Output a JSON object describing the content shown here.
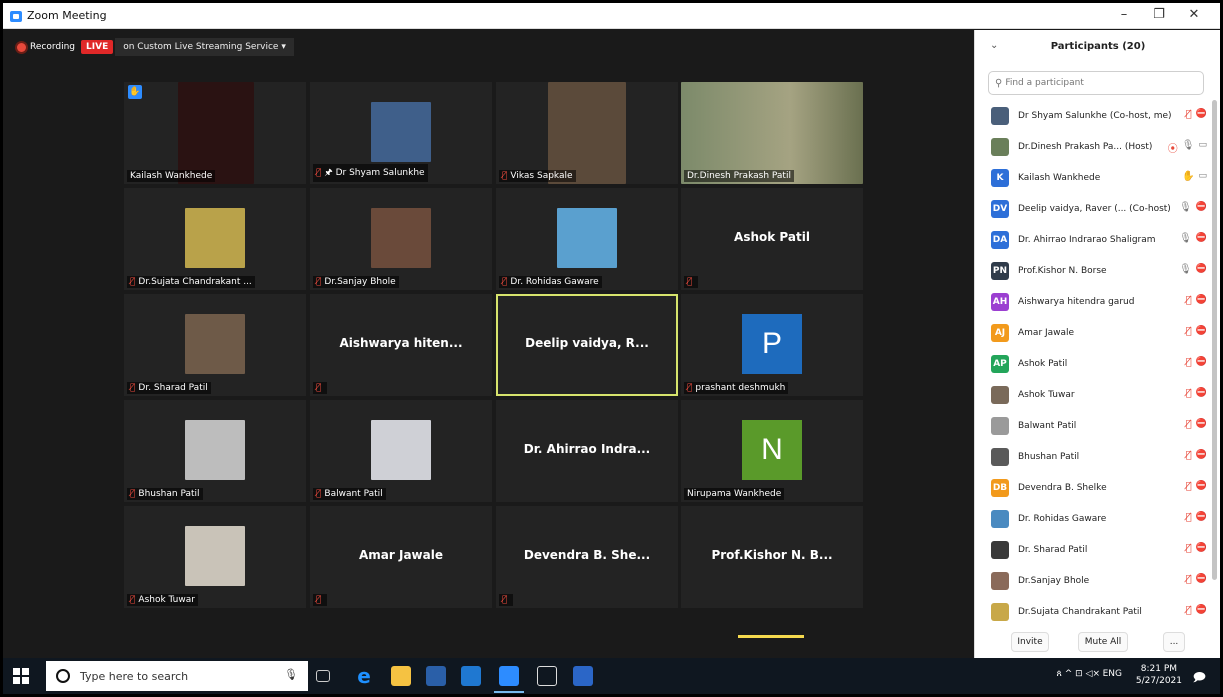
{
  "window": {
    "title": "Zoom Meeting",
    "minimize": "–",
    "restore": "❐",
    "close": "✕"
  },
  "topbar": {
    "recording": "Recording",
    "live": "LIVE",
    "stream": "on Custom Live Streaming Service  ▾"
  },
  "tiles": [
    {
      "name": "Kailash Wankhede",
      "center": "",
      "muted": false,
      "photo": "#2a1212",
      "letter": ""
    },
    {
      "name": "🖈 Dr Shyam Salunkhe",
      "center": "",
      "muted": true,
      "photo": "#3f5f8a",
      "letter": ""
    },
    {
      "name": "Vikas Sapkale",
      "center": "",
      "muted": true,
      "photo": "#5b4a3a",
      "letter": ""
    },
    {
      "name": "Dr.Dinesh Prakash Patil",
      "center": "",
      "muted": false,
      "photo": "#8a8f6a",
      "letter": ""
    },
    {
      "name": "Dr.Sujata Chandrakant ...",
      "center": "",
      "muted": true,
      "photo": "#b9a24a",
      "letter": ""
    },
    {
      "name": "Dr.Sanjay Bhole",
      "center": "",
      "muted": true,
      "photo": "#6a4a3a",
      "letter": ""
    },
    {
      "name": "Dr. Rohidas Gaware",
      "center": "",
      "muted": true,
      "photo": "#5aa0cf",
      "letter": ""
    },
    {
      "name": "",
      "center": "Ashok Patil",
      "muted": true,
      "photo": "",
      "letter": ""
    },
    {
      "name": "Dr. Sharad Patil",
      "center": "",
      "muted": true,
      "photo": "#6e5a48",
      "letter": ""
    },
    {
      "name": "",
      "center": "Aishwarya hiten...",
      "muted": true,
      "photo": "",
      "letter": ""
    },
    {
      "name": "",
      "center": "Deelip vaidya, R...",
      "muted": false,
      "photo": "",
      "letter": ""
    },
    {
      "name": "prashant deshmukh",
      "center": "",
      "muted": true,
      "photo": "",
      "letter": "P"
    },
    {
      "name": "Bhushan Patil",
      "center": "",
      "muted": true,
      "photo": "#bdbdbd",
      "letter": ""
    },
    {
      "name": "Balwant Patil",
      "center": "",
      "muted": true,
      "photo": "#cfd0d6",
      "letter": ""
    },
    {
      "name": "",
      "center": "Dr. Ahirrao Indra...",
      "muted": false,
      "photo": "",
      "letter": ""
    },
    {
      "name": "Nirupama Wankhede",
      "center": "",
      "muted": false,
      "photo": "",
      "letter": "N"
    },
    {
      "name": "Ashok Tuwar",
      "center": "",
      "muted": true,
      "photo": "#c9c3b8",
      "letter": ""
    },
    {
      "name": "",
      "center": "Amar Jawale",
      "muted": true,
      "photo": "",
      "letter": ""
    },
    {
      "name": "",
      "center": "Devendra B. She...",
      "muted": true,
      "photo": "",
      "letter": ""
    },
    {
      "name": "",
      "center": "Prof.Kishor N. B...",
      "muted": false,
      "photo": "",
      "letter": ""
    }
  ],
  "panel": {
    "title": "Participants (20)",
    "collapse": "⌄",
    "search_placeholder": "Find a participant",
    "invite": "Invite",
    "mute_all": "Mute All",
    "more": "...",
    "participants": [
      {
        "name": "Dr Shyam Salunkhe (Co-host, me)",
        "initials": "",
        "color": "#4a5f7a",
        "mic": "off",
        "video": "off"
      },
      {
        "name": "Dr.Dinesh Prakash Pa... (Host)",
        "initials": "",
        "color": "#6a7f5a",
        "mic": "on",
        "video": "on",
        "rec": "⦿"
      },
      {
        "name": "Kailash Wankhede",
        "initials": "K",
        "color": "#2d6fd8",
        "mic": "hand",
        "video": "on"
      },
      {
        "name": "Deelip vaidya, Raver (... (Co-host)",
        "initials": "DV",
        "color": "#2d6fd8",
        "mic": "speaking",
        "video": "off"
      },
      {
        "name": "Dr. Ahirrao Indrarao Shaligram",
        "initials": "DA",
        "color": "#2d6fd8",
        "mic": "on",
        "video": "off"
      },
      {
        "name": "Prof.Kishor N. Borse",
        "initials": "PN",
        "color": "#2f3b4a",
        "mic": "on",
        "video": "off"
      },
      {
        "name": "Aishwarya hitendra garud",
        "initials": "AH",
        "color": "#9b3fd1",
        "mic": "off",
        "video": "off"
      },
      {
        "name": "Amar Jawale",
        "initials": "AJ",
        "color": "#f29a1c",
        "mic": "off",
        "video": "off"
      },
      {
        "name": "Ashok Patil",
        "initials": "AP",
        "color": "#23a55a",
        "mic": "off",
        "video": "off"
      },
      {
        "name": "Ashok Tuwar",
        "initials": "",
        "color": "#7a6a5a",
        "mic": "off",
        "video": "off"
      },
      {
        "name": "Balwant Patil",
        "initials": "",
        "color": "#9a9a9a",
        "mic": "off",
        "video": "off"
      },
      {
        "name": "Bhushan Patil",
        "initials": "",
        "color": "#5a5a5a",
        "mic": "off",
        "video": "off"
      },
      {
        "name": "Devendra B. Shelke",
        "initials": "DB",
        "color": "#f29a1c",
        "mic": "off",
        "video": "off"
      },
      {
        "name": "Dr. Rohidas Gaware",
        "initials": "",
        "color": "#4a8ac0",
        "mic": "off",
        "video": "off"
      },
      {
        "name": "Dr. Sharad Patil",
        "initials": "",
        "color": "#3a3a3a",
        "mic": "off",
        "video": "off"
      },
      {
        "name": "Dr.Sanjay Bhole",
        "initials": "",
        "color": "#8a6a5a",
        "mic": "off",
        "video": "off"
      },
      {
        "name": "Dr.Sujata Chandrakant Patil",
        "initials": "",
        "color": "#c8a848",
        "mic": "off",
        "video": "off"
      }
    ]
  },
  "taskbar": {
    "search_placeholder": "Type here to search",
    "lang": "ENG",
    "time": "8:21 PM",
    "date": "5/27/2021",
    "tray_icons": "ጰ  ^  ⊡ ◁× "
  }
}
